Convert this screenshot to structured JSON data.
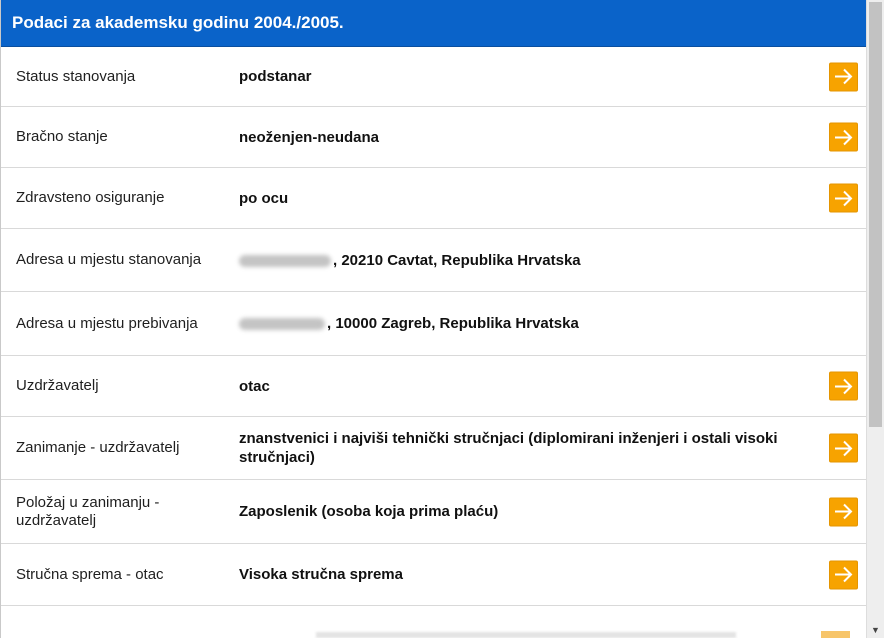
{
  "header": {
    "title": "Podaci za akademsku godinu 2004./2005."
  },
  "colors": {
    "header_bg": "#0a63c9",
    "arrow_bg": "#f7a300"
  },
  "rows": [
    {
      "label": "Status stanovanja",
      "value": "podstanar",
      "has_arrow": true
    },
    {
      "label": "Bračno stanje",
      "value": "neoženjen-neudana",
      "has_arrow": true
    },
    {
      "label": "Zdravsteno osiguranje",
      "value": "po ocu",
      "has_arrow": true
    },
    {
      "label": "Adresa u mjestu stanovanja",
      "value": ", 20210 Cavtat, Republika Hrvatska",
      "has_arrow": false,
      "redacted_prefix": true
    },
    {
      "label": "Adresa u mjestu prebivanja",
      "value": ", 10000 Zagreb, Republika Hrvatska",
      "has_arrow": false,
      "redacted_prefix": true
    },
    {
      "label": "Uzdržavatelj",
      "value": "otac",
      "has_arrow": true
    },
    {
      "label": "Zanimanje - uzdržavatelj",
      "value": "znanstvenici i najviši tehnički stručnjaci (diplomirani inženjeri i ostali visoki stručnjaci)",
      "has_arrow": true
    },
    {
      "label": "Položaj u zanimanju - uzdržavatelj",
      "value": "Zaposlenik (osoba koja prima plaću)",
      "has_arrow": true
    },
    {
      "label": "Stručna sprema - otac",
      "value": "Visoka stručna sprema",
      "has_arrow": true
    }
  ],
  "icons": {
    "arrow": "arrow-right-icon",
    "scroll_down": "scroll-down-arrow-icon"
  }
}
